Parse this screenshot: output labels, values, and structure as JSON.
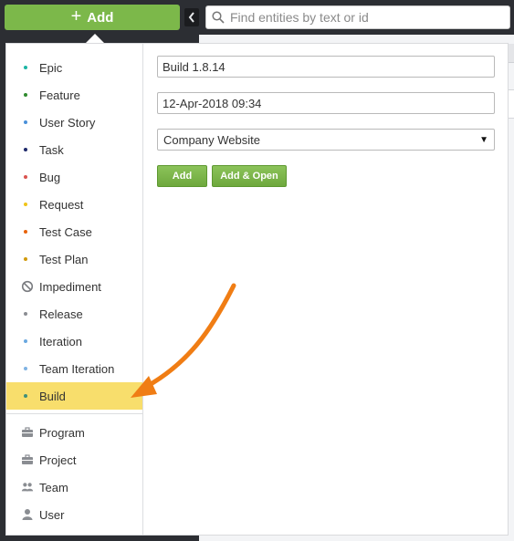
{
  "topbar": {
    "add_label": "Add",
    "search_placeholder": "Find entities by text or id"
  },
  "entities": [
    {
      "label": "Epic",
      "kind": "dot",
      "color": "#1bb5a4"
    },
    {
      "label": "Feature",
      "kind": "dot",
      "color": "#2f8a2e"
    },
    {
      "label": "User Story",
      "kind": "dot",
      "color": "#4a90d9"
    },
    {
      "label": "Task",
      "kind": "dot",
      "color": "#1f2a6b"
    },
    {
      "label": "Bug",
      "kind": "dot",
      "color": "#d9534f"
    },
    {
      "label": "Request",
      "kind": "dot",
      "color": "#f0c419"
    },
    {
      "label": "Test Case",
      "kind": "dot",
      "color": "#e8630a"
    },
    {
      "label": "Test Plan",
      "kind": "dot",
      "color": "#d19a0c"
    },
    {
      "label": "Impediment",
      "kind": "icon",
      "icon": "blocked-icon"
    },
    {
      "label": "Release",
      "kind": "dot",
      "color": "#8a8d92"
    },
    {
      "label": "Iteration",
      "kind": "dot",
      "color": "#6aa8e0"
    },
    {
      "label": "Team Iteration",
      "kind": "dot",
      "color": "#7fb3e3"
    },
    {
      "label": "Build",
      "kind": "dot",
      "color": "#3f8f7a",
      "selected": true
    },
    {
      "label": "Program",
      "kind": "icon",
      "icon": "briefcase-icon"
    },
    {
      "label": "Project",
      "kind": "icon",
      "icon": "briefcase-icon"
    },
    {
      "label": "Team",
      "kind": "icon",
      "icon": "team-icon"
    },
    {
      "label": "User",
      "kind": "icon",
      "icon": "user-icon"
    }
  ],
  "form": {
    "name_value": "Build 1.8.14",
    "date_value": "12-Apr-2018 09:34",
    "project_value": "Company Website",
    "add_button": "Add",
    "add_open_button": "Add & Open"
  },
  "colors": {
    "accent_green": "#7cb84a",
    "selected_highlight": "#f8de6c",
    "annotation_arrow": "#f07d14"
  }
}
